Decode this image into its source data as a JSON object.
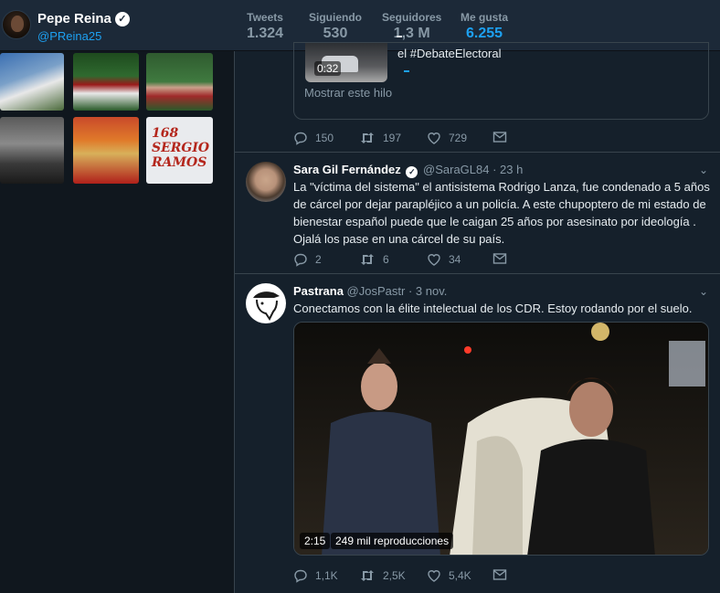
{
  "profile": {
    "name": "Pepe Reina",
    "handle": "@PReina25"
  },
  "stats": [
    {
      "label": "Tweets",
      "value": "1.324"
    },
    {
      "label": "Siguiendo",
      "value": "530"
    },
    {
      "label": "Seguidores",
      "value": "1,3 M"
    },
    {
      "label": "Me gusta",
      "value": "6.255"
    }
  ],
  "photo_tiles": {
    "tile6_text": "168 SERGIO RAMOS"
  },
  "tweet0": {
    "card": {
      "duration": "0:32",
      "text": "el #DebateElectoral"
    },
    "show_thread": "Mostrar este hilo",
    "replies": "150",
    "retweets": "197",
    "likes": "729"
  },
  "tweet1": {
    "name": "Sara Gil Fernández",
    "handle": "@SaraGL84",
    "time": "· 23 h",
    "text": "La \"víctima del sistema\" el antisistema Rodrigo Lanza, fue condenado a 5 años de cárcel por dejar parapléjico a un policía. A este chupoptero de mi estado de bienestar español puede que le caigan 25 años por asesinato por ideología . Ojalá los pase en una cárcel de su país.",
    "replies": "2",
    "retweets": "6",
    "likes": "34"
  },
  "tweet2": {
    "name": "Pastrana",
    "handle": "@JosPastr",
    "time": "· 3 nov.",
    "text": "Conectamos con la élite intelectual de los CDR. Estoy rodando por el suelo.",
    "video_duration": "2:15",
    "video_views": "249 mil reproducciones",
    "replies": "1,1K",
    "retweets": "2,5K",
    "likes": "5,4K"
  },
  "colors": {
    "accent": "#1da1f2",
    "background": "#15202b",
    "muted": "#8899a6"
  },
  "icons": [
    "reply-icon",
    "retweet-icon",
    "like-icon",
    "message-icon",
    "chevron-down-icon",
    "verified-icon"
  ]
}
